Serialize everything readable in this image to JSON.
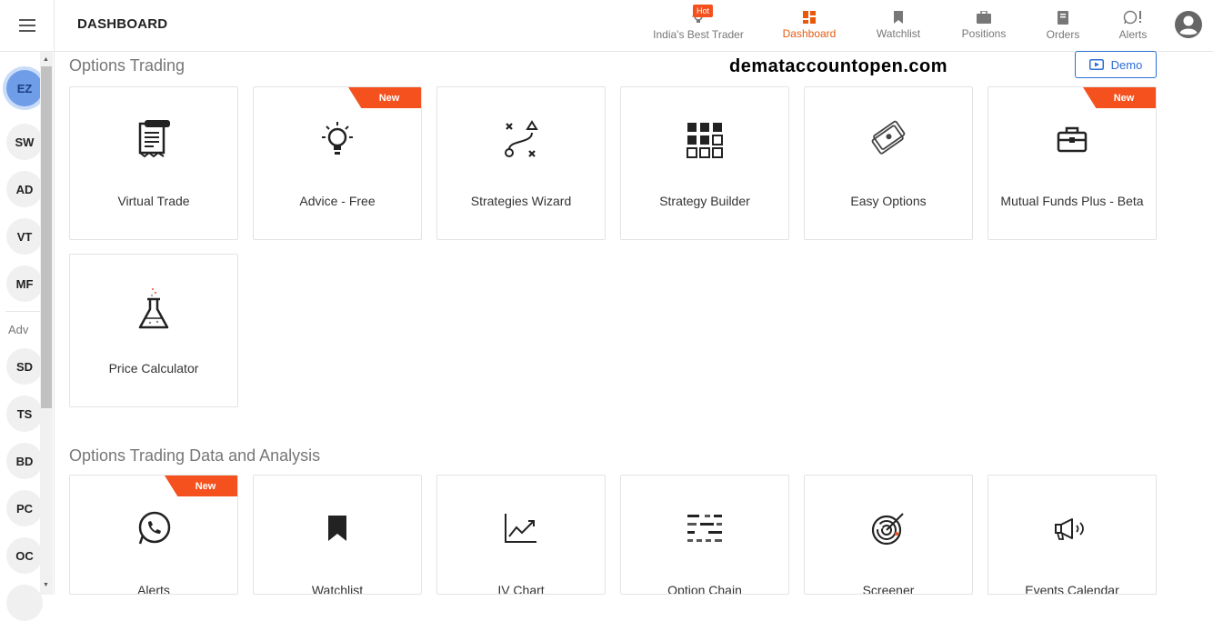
{
  "header": {
    "title": "DASHBOARD",
    "hot_badge": "Hot",
    "nav": [
      {
        "label": "India's Best Trader",
        "icon": "bulb-icon"
      },
      {
        "label": "Dashboard",
        "icon": "dashboard-icon",
        "active": true
      },
      {
        "label": "Watchlist",
        "icon": "bookmark-icon"
      },
      {
        "label": "Positions",
        "icon": "briefcase-icon"
      },
      {
        "label": "Orders",
        "icon": "orders-icon"
      },
      {
        "label": "Alerts",
        "icon": "whatsapp-icon"
      }
    ]
  },
  "sidebar": {
    "items": [
      "EZ",
      "SW",
      "AD",
      "VT",
      "MF"
    ],
    "adv_label": "Adv",
    "adv_items": [
      "SD",
      "TS",
      "BD",
      "PC",
      "OC"
    ]
  },
  "watermark": "demataccountopen.com",
  "demo_label": "Demo",
  "sections": [
    {
      "title": "Options Trading",
      "cards": [
        {
          "title": "Virtual Trade",
          "icon": "receipt-icon"
        },
        {
          "title": "Advice - Free",
          "icon": "lightbulb-icon",
          "badge": "New"
        },
        {
          "title": "Strategies Wizard",
          "icon": "strategy-path-icon"
        },
        {
          "title": "Strategy Builder",
          "icon": "grid-icon"
        },
        {
          "title": "Easy Options",
          "icon": "tickets-icon"
        },
        {
          "title": "Mutual Funds Plus - Beta",
          "icon": "toolbox-icon",
          "badge": "New"
        },
        {
          "title": "Price Calculator",
          "icon": "flask-icon"
        }
      ]
    },
    {
      "title": "Options Trading Data and Analysis",
      "cards": [
        {
          "title": "Alerts",
          "icon": "whatsapp-icon",
          "badge": "New"
        },
        {
          "title": "Watchlist",
          "icon": "bookmark-icon"
        },
        {
          "title": "IV Chart",
          "icon": "line-chart-icon"
        },
        {
          "title": "Option Chain",
          "icon": "option-chain-icon"
        },
        {
          "title": "Screener",
          "icon": "radar-icon"
        },
        {
          "title": "Events Calendar",
          "icon": "megaphone-icon"
        }
      ]
    }
  ],
  "colors": {
    "accent": "#f4511e",
    "active_nav": "#e8590c",
    "demo": "#2b6fd6"
  }
}
